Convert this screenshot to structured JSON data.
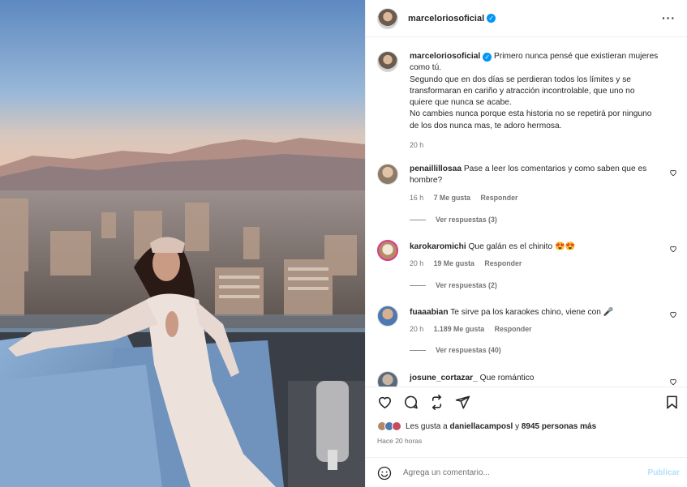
{
  "post": {
    "author": "marceloriosoficial",
    "caption_lines": [
      "Primero nunca pensé que existieran mujeres",
      "como tú.",
      "Segundo que en dos días se perdieran todos los límites y se",
      "transformaran en cariño y atracción incontrolable, que uno no",
      "quiere que nunca se acabe.",
      "No cambies nunca porque esta historia no se repetirá por ninguno",
      "de los dos nunca mas, te adoro hermosa."
    ],
    "caption_time": "20 h",
    "likes_prefix": "Les gusta a ",
    "likes_user": "daniellacamposl",
    "likes_mid": " y ",
    "likes_count": "8945 personas más",
    "posted_ago": "Hace 20 horas"
  },
  "comments": [
    {
      "user": "penaillillosaa",
      "text": "Pase a leer los comentarios y como saben que es",
      "text2": "hombre?",
      "time": "16 h",
      "likes": "7 Me gusta",
      "reply": "Responder",
      "replies": "Ver respuestas (3)"
    },
    {
      "user": "karokaromichi",
      "text": "Que galán es el chinito 😍😍",
      "time": "20 h",
      "likes": "19 Me gusta",
      "reply": "Responder",
      "replies": "Ver respuestas (2)"
    },
    {
      "user": "fuaaabian",
      "text": "Te sirve pa los karaokes chino, viene con 🎤",
      "time": "20 h",
      "likes": "1.189 Me gusta",
      "reply": "Responder",
      "replies": "Ver respuestas (40)"
    },
    {
      "user": "josune_cortazar_",
      "text": "Que romántico"
    }
  ],
  "add_comment": {
    "placeholder": "Agrega un comentario...",
    "publish": "Publicar"
  },
  "icons": [
    "more-icon",
    "heart-icon",
    "comment-icon",
    "share-icon",
    "send-icon",
    "bookmark-icon",
    "emoji-icon",
    "verified-icon"
  ],
  "colors": {
    "accent": "#0095f6",
    "muted": "#737373",
    "publish_disabled": "#b2dffc"
  }
}
